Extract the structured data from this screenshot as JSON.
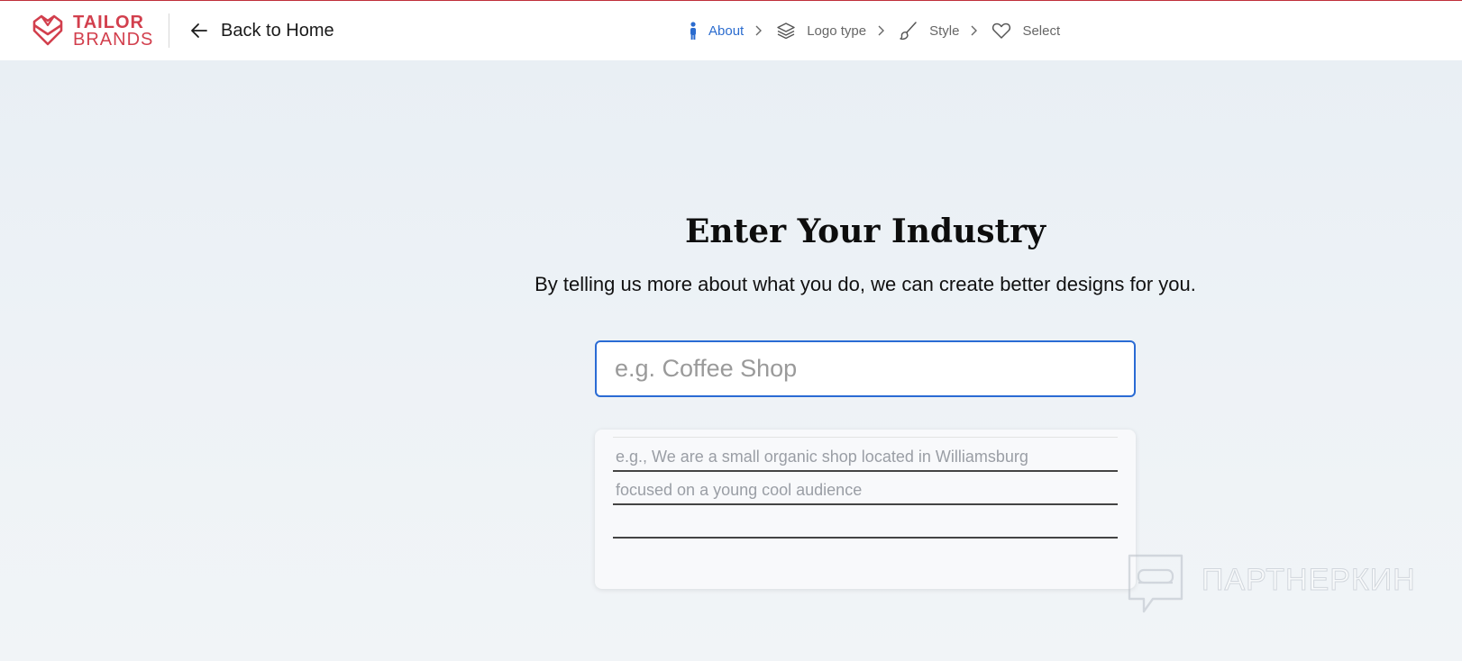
{
  "brand": {
    "line1": "TAILOR",
    "line2": "BRANDS",
    "color": "#d23f4d",
    "icon": "tailor-brands-logo-icon"
  },
  "nav": {
    "back_label": "Back to Home",
    "back_icon": "arrow-left-icon"
  },
  "steps": [
    {
      "label": "About",
      "icon": "person-icon",
      "active": true
    },
    {
      "label": "Logo type",
      "icon": "layers-icon",
      "active": false
    },
    {
      "label": "Style",
      "icon": "brush-icon",
      "active": false
    },
    {
      "label": "Select",
      "icon": "heart-icon",
      "active": false
    }
  ],
  "main": {
    "title": "Enter Your Industry",
    "subtitle": "By telling us more about what you do, we can create better designs for you.",
    "industry_placeholder": "e.g. Coffee Shop",
    "description_lines": [
      "e.g., We are a small organic shop located in Williamsburg",
      "focused on a young cool audience",
      ""
    ]
  },
  "watermark": {
    "text": "ПАРТНЕРКИН"
  },
  "colors": {
    "accent": "#2b6ccf",
    "input_border": "#2a6bd4",
    "brand": "#d23f4d"
  }
}
